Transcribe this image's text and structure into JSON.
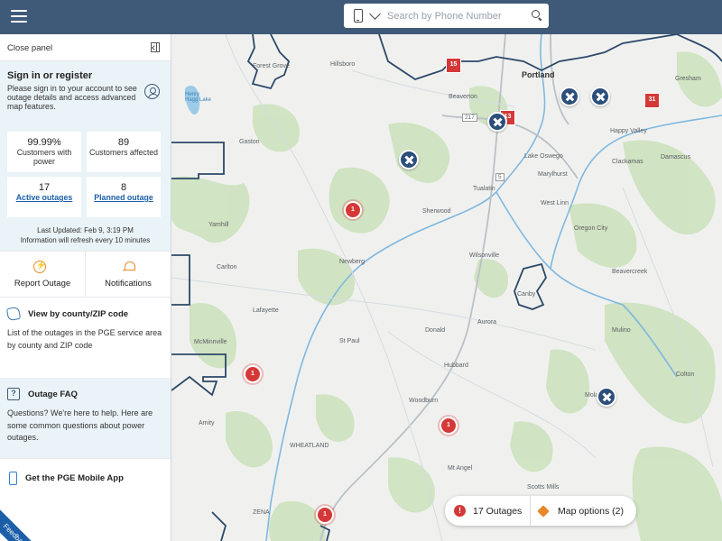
{
  "header": {
    "menu_icon": "hamburger-icon",
    "search": {
      "device_icon": "phone-icon",
      "placeholder": "Search by Phone Number",
      "value": "",
      "search_icon": "search-icon"
    }
  },
  "panel": {
    "close_label": "Close panel",
    "signin": {
      "title": "Sign in or register",
      "description": "Please sign in to your account to see outage details and access advanced map features."
    },
    "stats": {
      "customers_power_value": "99.99%",
      "customers_power_label": "Customers with power",
      "customers_affected_value": "89",
      "customers_affected_label": "Customers affected",
      "active_outages_value": "17",
      "active_outages_label": "Active outages",
      "planned_outage_value": "8",
      "planned_outage_label": "Planned outage"
    },
    "last_updated": "Last Updated: Feb 9, 3:19 PM",
    "refresh_note": "Information will refresh every 10 minutes",
    "actions": {
      "report": "Report Outage",
      "notifications": "Notifications"
    },
    "county": {
      "title": "View by county/ZIP code",
      "body": "List of the outages in the PGE service area by county and ZIP code"
    },
    "faq": {
      "title": "Outage FAQ",
      "body": "Questions? We're here to help. Here are some common questions about power outages."
    },
    "mobile": {
      "title": "Get the PGE Mobile App"
    },
    "feedback": "Feedback"
  },
  "map": {
    "places": [
      {
        "name": "Forest Grove",
        "big": false
      },
      {
        "name": "Hillsboro",
        "big": false
      },
      {
        "name": "Portland",
        "big": true
      },
      {
        "name": "Gresham",
        "big": false
      },
      {
        "name": "Beaverton",
        "big": false
      },
      {
        "name": "Happy Valley",
        "big": false
      },
      {
        "name": "Gaston",
        "big": false
      },
      {
        "name": "Lake Oswego",
        "big": false
      },
      {
        "name": "Damascus",
        "big": false
      },
      {
        "name": "Clackamas",
        "big": false
      },
      {
        "name": "Marylhurst",
        "big": false
      },
      {
        "name": "Tualatin",
        "big": false
      },
      {
        "name": "West Linn",
        "big": false
      },
      {
        "name": "Sherwood",
        "big": false
      },
      {
        "name": "Yamhill",
        "big": false
      },
      {
        "name": "Oregon City",
        "big": false
      },
      {
        "name": "Wilsonville",
        "big": false
      },
      {
        "name": "Carlton",
        "big": false
      },
      {
        "name": "Newberg",
        "big": false
      },
      {
        "name": "Beavercreek",
        "big": false
      },
      {
        "name": "Canby",
        "big": false
      },
      {
        "name": "Lafayette",
        "big": false
      },
      {
        "name": "Donald",
        "big": false
      },
      {
        "name": "Aurora",
        "big": false
      },
      {
        "name": "Mulino",
        "big": false
      },
      {
        "name": "McMinnville",
        "big": false
      },
      {
        "name": "St Paul",
        "big": false
      },
      {
        "name": "Hubbard",
        "big": false
      },
      {
        "name": "Colton",
        "big": false
      },
      {
        "name": "Woodburn",
        "big": false
      },
      {
        "name": "Amity",
        "big": false
      },
      {
        "name": "WHEATLAND",
        "big": false
      },
      {
        "name": "Mt Angel",
        "big": false
      },
      {
        "name": "Scotts Mills",
        "big": false
      },
      {
        "name": "ZENA",
        "big": false
      },
      {
        "name": "Henry Hagg Lake",
        "big": false
      },
      {
        "name": "Molalla",
        "big": false
      }
    ],
    "route_labels": [
      "217",
      "5"
    ],
    "clusters": [
      "1",
      "1",
      "1",
      "1"
    ],
    "squares": [
      "15",
      "13",
      "31"
    ],
    "crew_icon": "repair-crew-icon",
    "outages_button": "17 Outages",
    "map_options_button": "Map options (2)",
    "colors": {
      "outage_red": "#d43837",
      "crew_blue": "#2c4e7a",
      "header": "#3f5a78",
      "accent_orange": "#e7892b"
    }
  }
}
